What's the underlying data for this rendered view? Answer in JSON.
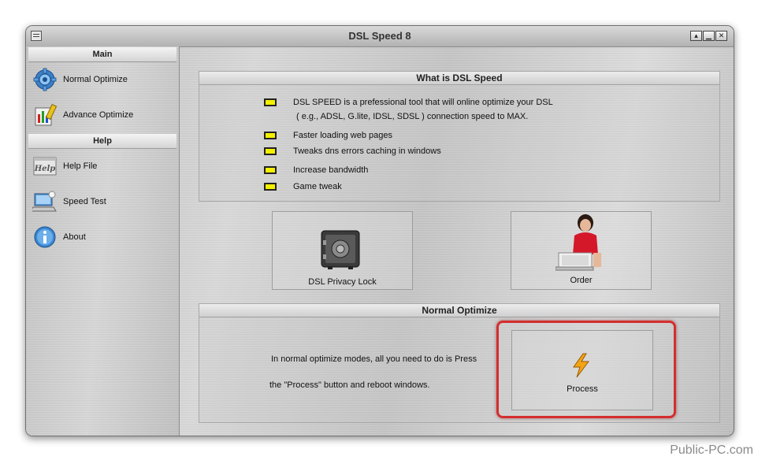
{
  "window": {
    "title": "DSL Speed 8",
    "controls": [
      "▴",
      "▁",
      "✕"
    ]
  },
  "sidebar": {
    "main_header": "Main",
    "help_header": "Help",
    "main_items": [
      {
        "label": "Normal Optimize",
        "icon": "gear-icon"
      },
      {
        "label": "Advance Optimize",
        "icon": "tools-icon"
      }
    ],
    "help_items": [
      {
        "label": "Help File",
        "icon": "help-book-icon"
      },
      {
        "label": "Speed Test",
        "icon": "speed-test-icon"
      },
      {
        "label": "About",
        "icon": "info-icon"
      }
    ]
  },
  "what_is": {
    "header": "What is DSL Speed",
    "features": [
      {
        "line1": "DSL SPEED is a prefessional tool that will online optimize your DSL",
        "line2": "( e.g., ADSL, G.lite, IDSL, SDSL ) connection speed to MAX."
      },
      {
        "line1": "Faster loading web pages"
      },
      {
        "line1": "Tweaks dns errors caching in windows"
      },
      {
        "line1": "Increase bandwidth"
      },
      {
        "line1": "Game tweak"
      }
    ],
    "bullet_color": "#f3f000"
  },
  "buttons": {
    "privacy_lock": {
      "label": "DSL Privacy Lock",
      "icon": "safe-icon"
    },
    "order": {
      "label": "Order",
      "icon": "person-laptop-icon"
    }
  },
  "normal_optimize": {
    "header": "Normal Optimize",
    "line1": "In normal optimize modes, all you need to do is Press",
    "line2": "the \"Process\" button and reboot windows.",
    "process_label": "Process",
    "process_icon": "lightning-icon"
  },
  "highlight_color": "#d42e2e",
  "watermark": "Public-PC.com"
}
